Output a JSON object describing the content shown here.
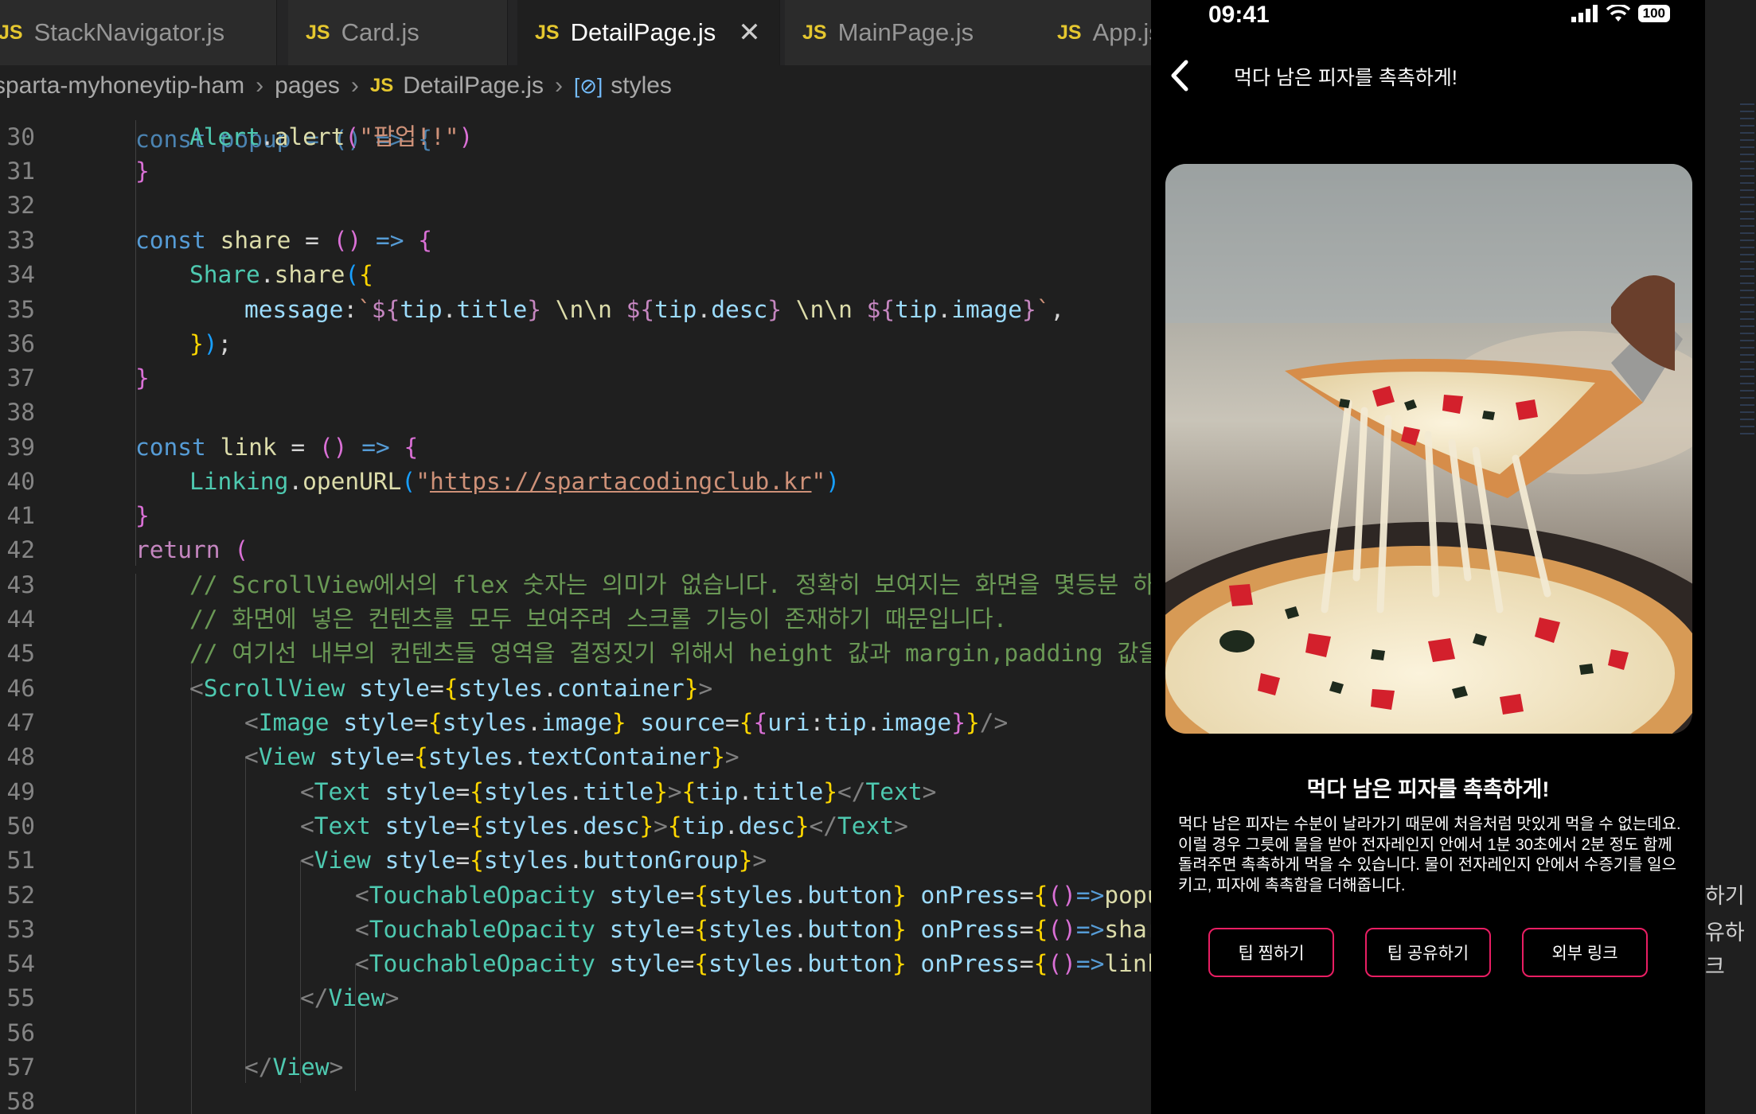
{
  "editor": {
    "tabs": [
      {
        "label": "StackNavigator.js",
        "active": false
      },
      {
        "label": "Card.js",
        "active": false
      },
      {
        "label": "DetailPage.js",
        "active": true
      },
      {
        "label": "MainPage.js",
        "active": false
      },
      {
        "label": "App.js",
        "active": false
      }
    ],
    "tab_icon": "JS",
    "breadcrumb": [
      "sparta-myhoneytip-ham",
      "pages",
      "DetailPage.js",
      "styles"
    ],
    "line_numbers": [
      "30",
      "31",
      "32",
      "33",
      "34",
      "35",
      "36",
      "37",
      "38",
      "39",
      "40",
      "41",
      "42",
      "43",
      "44",
      "45",
      "46",
      "47",
      "48",
      "49",
      "50",
      "51",
      "52",
      "53",
      "54",
      "55",
      "56",
      "57",
      "58"
    ],
    "partial_top_line": "const popup = () => {"
  },
  "phone": {
    "time": "09:41",
    "battery": "100",
    "nav_title": "먹다 남은 피자를 촉촉하게!",
    "tip_title": "먹다 남은 피자를 촉촉하게!",
    "tip_desc": "먹다 남은 피자는 수분이 날라가기 때문에 처음처럼 맛있게 먹을 수 없는데요. 이럴 경우 그릇에 물을 받아 전자레인지 안에서 1분 30초에서 2분 정도 함께 돌려주면 촉촉하게 먹을 수 있습니다. 물이 전자레인지 안에서 수증기를 일으키고, 피자에 촉촉함을 더해줍니다.",
    "buttons": [
      "팁 찜하기",
      "팁 공유하기",
      "외부 링크"
    ]
  },
  "right_strip": [
    "하기",
    "유하",
    "크"
  ]
}
